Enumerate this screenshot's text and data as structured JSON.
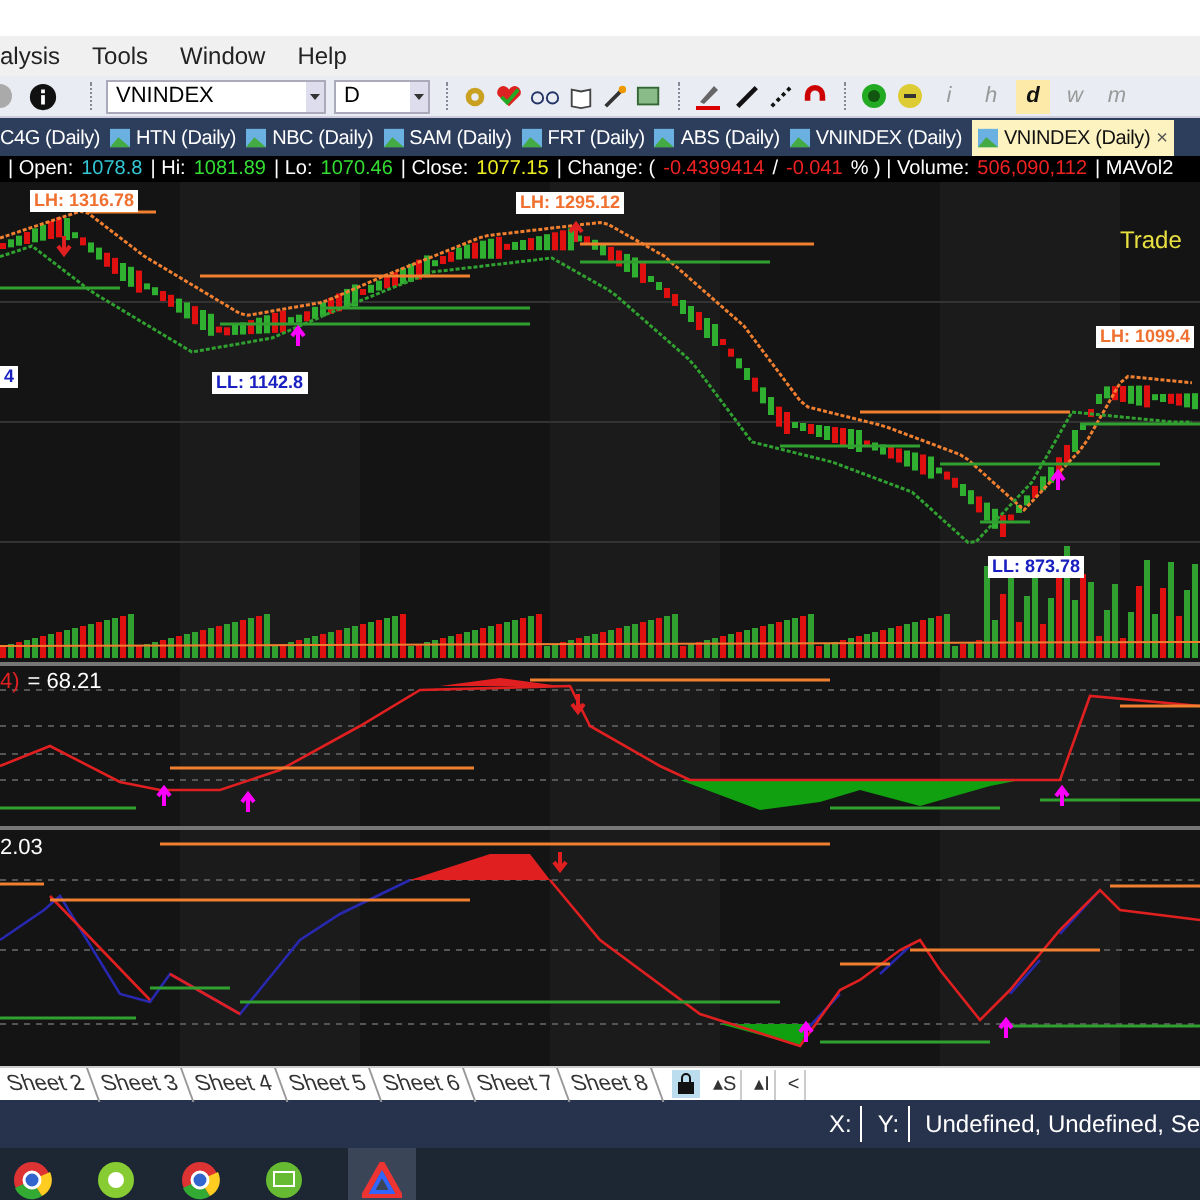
{
  "menu": [
    "alysis",
    "Tools",
    "Window",
    "Help"
  ],
  "toolbar": {
    "symbol": "VNINDEX",
    "interval": "D",
    "periods": [
      {
        "label": "i",
        "selected": false
      },
      {
        "label": "h",
        "selected": false
      },
      {
        "label": "d",
        "selected": true
      },
      {
        "label": "w",
        "selected": false
      },
      {
        "label": "m",
        "selected": false
      }
    ]
  },
  "tabs": [
    {
      "label": "C4G (Daily)",
      "selected": false
    },
    {
      "label": "HTN (Daily)",
      "selected": false
    },
    {
      "label": "NBC (Daily)",
      "selected": false
    },
    {
      "label": "SAM (Daily)",
      "selected": false
    },
    {
      "label": "FRT (Daily)",
      "selected": false
    },
    {
      "label": "ABS (Daily)",
      "selected": false
    },
    {
      "label": "VNINDEX (Daily)",
      "selected": false
    },
    {
      "label": "VNINDEX (Daily)",
      "selected": true,
      "close": "×"
    }
  ],
  "quote": [
    {
      "label": "| Open:",
      "value": "1078.8",
      "color": "#33c6d6"
    },
    {
      "label": "| Hi:",
      "value": "1081.89",
      "color": "#33dd33"
    },
    {
      "label": "| Lo:",
      "value": "1070.46",
      "color": "#33dd33"
    },
    {
      "label": "| Close:",
      "value": "1077.15",
      "color": "#eeee22"
    },
    {
      "label": "| Change: (",
      "value": "-0.4399414",
      "color": "#ee2222"
    },
    {
      "label": "/",
      "value": "-0.041",
      "color": "#ee2222"
    },
    {
      "label": "% ) | Volume:",
      "value": "506,090,112",
      "color": "#ee2222"
    },
    {
      "label": "| MAVol2"
    }
  ],
  "chart_labels": [
    {
      "kind": "high",
      "text": "LH: 1316.78"
    },
    {
      "kind": "high",
      "text": "LH: 1295.12"
    },
    {
      "kind": "low",
      "text": "LL: 1142.8"
    },
    {
      "kind": "low",
      "text": "4"
    },
    {
      "kind": "high",
      "text": "LH: 1099.4"
    },
    {
      "kind": "low",
      "text": "LL: 873.78"
    }
  ],
  "trade_label": "Trade",
  "pane1_label": {
    "prefix": "4)",
    "value": "= 68.21"
  },
  "pane2_label": "2.03",
  "sheets": [
    "Sheet 2",
    "Sheet 3",
    "Sheet 4",
    "Sheet 5",
    "Sheet 6",
    "Sheet 7",
    "Sheet 8"
  ],
  "sheet_buttons": [
    "▴S",
    "▴I",
    "<"
  ],
  "status": [
    "X:",
    "Y:",
    "Undefined, Undefined, Se"
  ]
}
